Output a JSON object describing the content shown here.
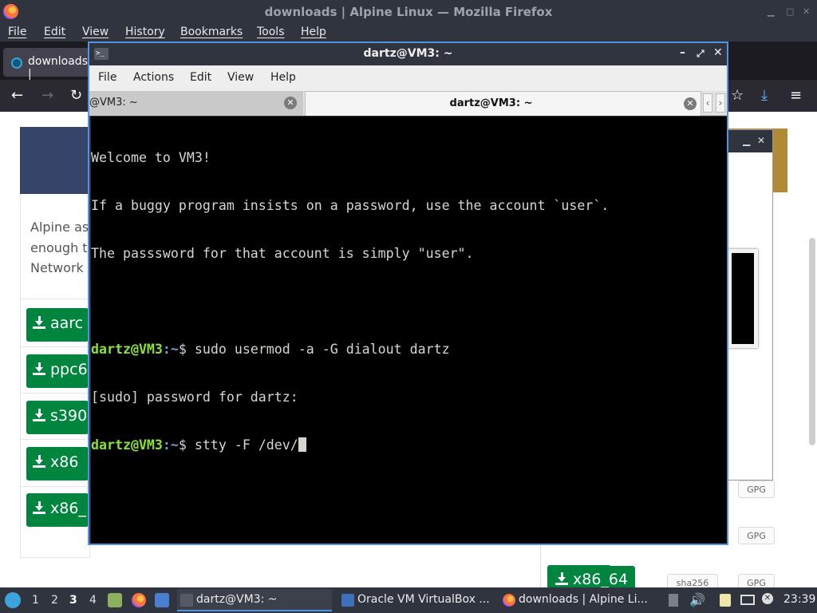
{
  "firefox": {
    "window_title": "downloads | Alpine Linux — Mozilla Firefox",
    "menu": [
      "File",
      "Edit",
      "View",
      "History",
      "Bookmarks",
      "Tools",
      "Help"
    ],
    "tab_label": "downloads |",
    "page": {
      "text_lines": [
        "Alpine as",
        "enough t",
        "Network"
      ],
      "download_buttons": [
        "aarc",
        "ppc6",
        "s390",
        "x86",
        "x86_"
      ],
      "right_buttons": [
        "x86_64"
      ],
      "sha_label": "sha256",
      "gpg_label": "GPG"
    }
  },
  "terminal": {
    "window_title": "dartz@VM3: ~",
    "menu": [
      "File",
      "Actions",
      "Edit",
      "View",
      "Help"
    ],
    "tabs": [
      {
        "label": "@VM3: ~",
        "active": false
      },
      {
        "label": "dartz@VM3: ~",
        "active": true
      }
    ],
    "lines": [
      {
        "type": "text",
        "text": "Welcome to VM3!"
      },
      {
        "type": "text",
        "text": "If a buggy program insists on a password, use the account `user`."
      },
      {
        "type": "text",
        "text": "The passsword for that account is simply \"user\"."
      },
      {
        "type": "text",
        "text": ""
      },
      {
        "type": "prompt",
        "user": "dartz@VM3",
        "path": ":~",
        "sym": "$ ",
        "cmd": "sudo usermod -a -G dialout dartz"
      },
      {
        "type": "text",
        "text": "[sudo] password for dartz:"
      },
      {
        "type": "prompt",
        "user": "dartz@VM3",
        "path": ":~",
        "sym": "$ ",
        "cmd": "stty -F /dev/"
      }
    ]
  },
  "taskbar": {
    "workspaces": [
      "1",
      "2",
      "3",
      "4"
    ],
    "active_workspace": "3",
    "tasks": [
      {
        "label": "dartz@VM3: ~",
        "active": true
      },
      {
        "label": "Oracle VM VirtualBox ...",
        "active": false
      },
      {
        "label": "downloads | Alpine Li...",
        "active": false
      }
    ],
    "clock": "23:39"
  },
  "colors": {
    "accent": "#5294e2",
    "prompt_user": "#8ae234",
    "prompt_path": "#729fcf",
    "download_green": "#00853e"
  }
}
